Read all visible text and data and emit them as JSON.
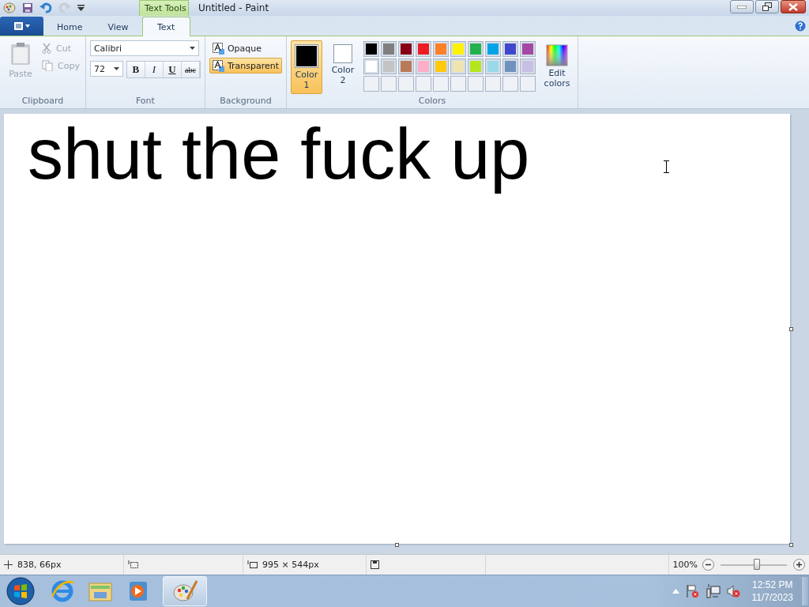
{
  "title_bar": {
    "contextual_tab": "Text Tools",
    "title": "Untitled - Paint"
  },
  "tabs": [
    {
      "label": "Home",
      "selected": false
    },
    {
      "label": "View",
      "selected": false
    },
    {
      "label": "Text",
      "selected": true
    }
  ],
  "clipboard": {
    "paste": "Paste",
    "cut": "Cut",
    "copy": "Copy",
    "label": "Clipboard",
    "disabled": true
  },
  "font": {
    "family": "Calibri",
    "size": "72",
    "label": "Font",
    "styles": [
      {
        "label": "B",
        "kind": "bold",
        "selected": false
      },
      {
        "label": "I",
        "kind": "italic",
        "selected": false
      },
      {
        "label": "U",
        "kind": "underline",
        "selected": false
      },
      {
        "label": "abc",
        "kind": "strike",
        "selected": false
      }
    ]
  },
  "background": {
    "label": "Background",
    "options": [
      {
        "label": "Opaque",
        "selected": false
      },
      {
        "label": "Transparent",
        "selected": true
      }
    ]
  },
  "colors": {
    "label": "Colors",
    "edit": "Edit colors",
    "slots": [
      {
        "label": "Color 1",
        "color": "#000000",
        "selected": true
      },
      {
        "label": "Color 2",
        "color": "#ffffff",
        "selected": false
      }
    ],
    "palette": [
      {
        "color": "#000000"
      },
      {
        "color": "#7f7f7f"
      },
      {
        "color": "#880015"
      },
      {
        "color": "#ed1c24"
      },
      {
        "color": "#ff7f27"
      },
      {
        "color": "#fff200"
      },
      {
        "color": "#22b14c"
      },
      {
        "color": "#00a2e8"
      },
      {
        "color": "#3f48cc"
      },
      {
        "color": "#a349a4"
      },
      {
        "color": "#ffffff"
      },
      {
        "color": "#c3c3c3"
      },
      {
        "color": "#b97a57"
      },
      {
        "color": "#ffaec9"
      },
      {
        "color": "#ffc90e"
      },
      {
        "color": "#efe4b0"
      },
      {
        "color": "#b5e61d"
      },
      {
        "color": "#99d9ea"
      },
      {
        "color": "#7092be"
      },
      {
        "color": "#c8bfe7"
      }
    ]
  },
  "canvas": {
    "text": "shut the fuck up"
  },
  "status_bar": {
    "cursor": "838, 66px",
    "size": "995 × 544px",
    "zoom": "100%",
    "zoom_slider": {
      "level": 0.55
    }
  },
  "taskbar": {
    "time": "12:52 PM",
    "date": "11/7/2023"
  }
}
